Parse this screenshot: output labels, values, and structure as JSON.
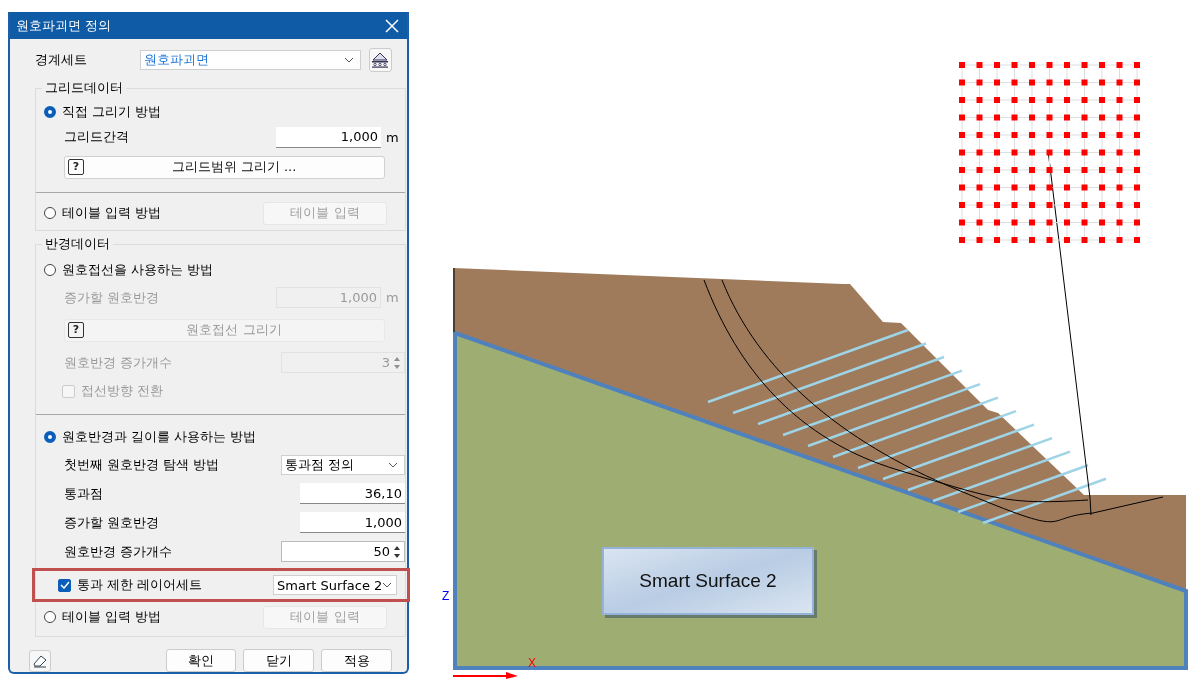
{
  "window": {
    "title": "원호파괴면 정의"
  },
  "boundary_set": {
    "label": "경계세트",
    "value": "원호파괴면"
  },
  "sections": [
    {
      "title": "그리드데이터",
      "rows": [
        {
          "kind": "radio",
          "label": "직접 그리기 방법",
          "selected": true
        },
        {
          "kind": "field",
          "label": "그리드간격",
          "value": "1,000",
          "unit": "m",
          "disabled": false
        },
        {
          "kind": "help_button",
          "icon": "?",
          "label": "그리드범위 그리기 ...",
          "disabled": false
        },
        {
          "kind": "divider"
        },
        {
          "kind": "radio_button",
          "label": "테이블 입력 방법",
          "selected": false,
          "button": "테이블 입력",
          "disabled": true
        }
      ]
    },
    {
      "title": "반경데이터",
      "rows": [
        {
          "kind": "radio",
          "label": "원호접선을 사용하는 방법",
          "selected": false
        },
        {
          "kind": "field",
          "label": "증가할 원호반경",
          "value": "1,000",
          "unit": "m",
          "disabled": true
        },
        {
          "kind": "help_button",
          "icon": "?",
          "label": "원호접선 그리기",
          "disabled": true
        },
        {
          "kind": "spinner",
          "label": "원호반경 증가개수",
          "value": "3",
          "disabled": true
        },
        {
          "kind": "checkbox",
          "label": "접선방향 전환",
          "checked": false,
          "disabled": true
        },
        {
          "kind": "divider"
        },
        {
          "kind": "radio",
          "label": "원호반경과 길이를 사용하는 방법",
          "selected": true
        },
        {
          "kind": "select",
          "label": "첫번째 원호반경 탐색 방법",
          "value": "통과점 정의",
          "disabled": false
        },
        {
          "kind": "field",
          "label": "통과점",
          "value": "36,10",
          "disabled": false
        },
        {
          "kind": "field",
          "label": "증가할 원호반경",
          "value": "1,000",
          "disabled": false
        },
        {
          "kind": "spinner",
          "label": "원호반경 증가개수",
          "value": "50",
          "disabled": false
        },
        {
          "kind": "checkbox_select",
          "label": "통과 제한 레이어세트",
          "checked": true,
          "value": "Smart Surface 2",
          "highlighted": true
        },
        {
          "kind": "radio_button",
          "label": "테이블 입력 방법",
          "selected": false,
          "button": "테이블 입력",
          "disabled": true
        }
      ]
    }
  ],
  "footer_buttons": [
    "확인",
    "닫기",
    "적용"
  ],
  "canvas": {
    "label": "Smart Surface 2",
    "axis_z": "Z",
    "axis_x": "X"
  }
}
